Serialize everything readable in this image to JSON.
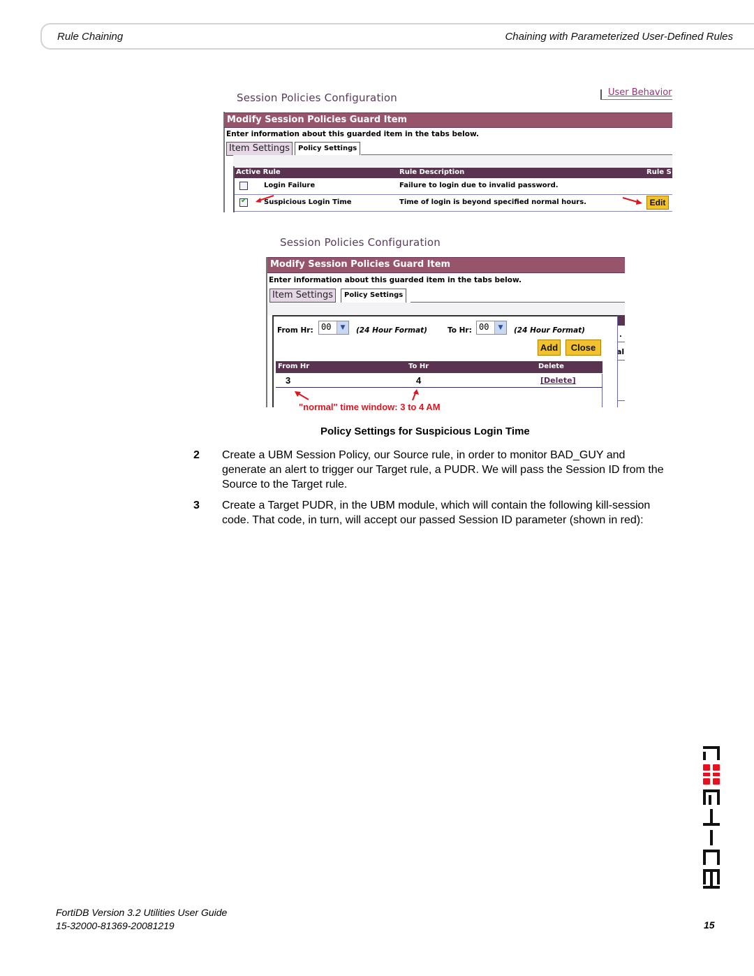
{
  "header": {
    "left": "Rule Chaining",
    "right": "Chaining with Parameterized User-Defined Rules"
  },
  "screenshot1": {
    "title": "Session Policies Configuration",
    "link": "User Behavior",
    "bar_title": "Modify Session Policies Guard Item",
    "info": "Enter information about this guarded item in the tabs below.",
    "tabs": [
      "Item Settings",
      "Policy Settings"
    ],
    "columns": [
      "Active Rule",
      "Rule Description",
      "Rule S"
    ],
    "rows": [
      {
        "checked": false,
        "rule": "Login Failure",
        "description": "Failure to login due to invalid password."
      },
      {
        "checked": true,
        "rule": "Suspicious Login Time",
        "description": "Time of login is beyond specified normal hours.",
        "action": "Edit"
      }
    ]
  },
  "screenshot2": {
    "title": "Session Policies Configuration",
    "bar_title": "Modify Session Policies Guard Item",
    "info": "Enter information about this guarded item in the tabs below.",
    "tabs": [
      "Item Settings",
      "Policy Settings"
    ],
    "from_label": "From Hr:",
    "from_value": "00",
    "to_label": "To Hr:",
    "to_value": "00",
    "format_hint": "(24 Hour Format)",
    "add_label": "Add",
    "close_label": "Close",
    "columns": [
      "From Hr",
      "To Hr",
      "Delete"
    ],
    "rows": [
      {
        "from": "3",
        "to": "4",
        "delete": "[Delete]"
      }
    ],
    "side_fragments": [
      ".",
      "al"
    ],
    "annotation": "\"normal\" time window: 3 to 4 AM"
  },
  "caption": "Policy Settings for Suspicious Login Time",
  "steps": [
    {
      "num": "2",
      "text": "Create a UBM Session Policy, our Source rule, in order to monitor BAD_GUY and generate an alert to trigger our Target rule, a PUDR. We will pass the Session ID from the Source to the Target rule."
    },
    {
      "num": "3",
      "text": "Create a Target PUDR, in the UBM module, which will contain the following kill-session code. That code, in turn, will accept our passed Session ID parameter (shown in red):"
    }
  ],
  "footer": {
    "line1": "FortiDB Version 3.2 Utilities  User Guide",
    "line2": "15-32000-81369-20081219",
    "page": "15"
  },
  "logo": {
    "name": "FORTINET",
    "accent": "#e8101e"
  }
}
